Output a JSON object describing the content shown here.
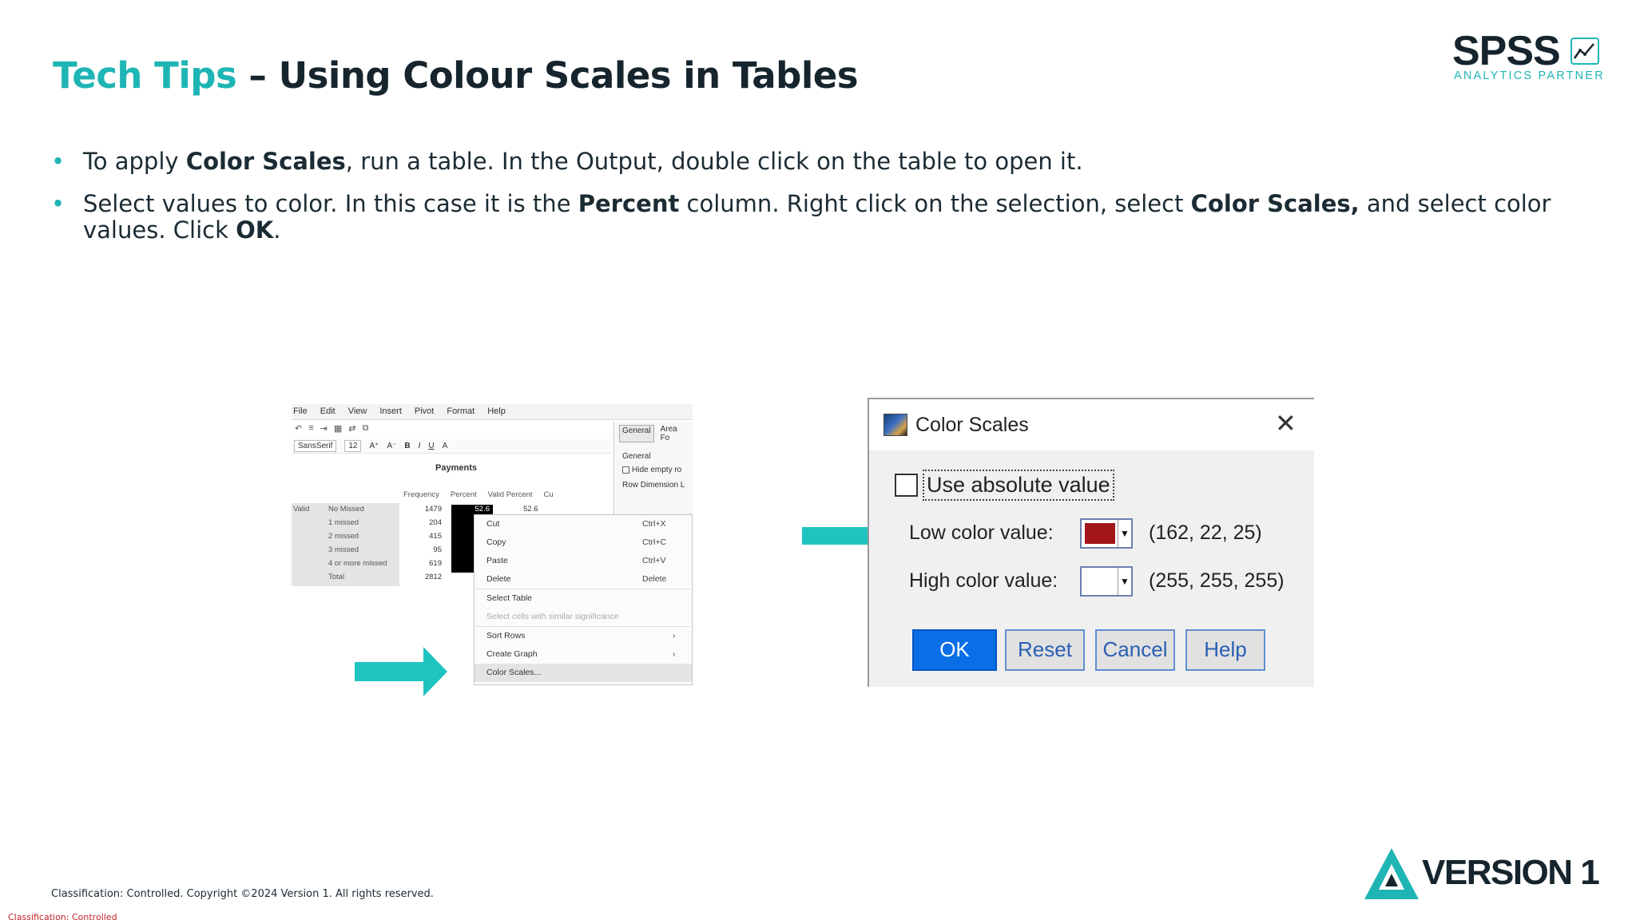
{
  "title": {
    "accent": "Tech Tips",
    "rest": " – Using Colour Scales in Tables"
  },
  "logo": {
    "brand": "SPSS",
    "tagline": "ANALYTICS PARTNER"
  },
  "bullets": [
    {
      "p1": "To apply ",
      "b1": "Color Scales",
      "p2": ", run a table. In the Output, double click on the table to open it."
    },
    {
      "p1": "Select values to color. In this case it is the ",
      "b1": "Percent",
      "p2": " column. Right click on the selection, select ",
      "b2": "Color Scales,",
      "p3": "  and select color values. Click ",
      "b3": "OK",
      "p4": "."
    }
  ],
  "spss": {
    "menu": [
      "File",
      "Edit",
      "View",
      "Insert",
      "Pivot",
      "Format",
      "Help"
    ],
    "toolbar": {
      "font": "SansSerif",
      "size": "12"
    },
    "side_tabs": [
      "General",
      "Area Fo"
    ],
    "side_group": "General",
    "side_option": "Hide empty ro",
    "side_row_label": "Row Dimension L",
    "table_title": "Payments",
    "columns": [
      "Frequency",
      "Percent",
      "Valid Percent",
      "Cu"
    ],
    "group_label": "Valid",
    "rows": [
      {
        "label": "No Missed",
        "freq": "1479",
        "pct": "52.6",
        "vp": "52.6"
      },
      {
        "label": "1 missed",
        "freq": "204"
      },
      {
        "label": "2 missed",
        "freq": "415"
      },
      {
        "label": "3 missed",
        "freq": "95"
      },
      {
        "label": "4 or more missed",
        "freq": "619"
      },
      {
        "label": "Total",
        "freq": "2812"
      }
    ],
    "context_menu": [
      {
        "label": "Cut",
        "shortcut": "Ctrl+X"
      },
      {
        "label": "Copy",
        "shortcut": "Ctrl+C"
      },
      {
        "label": "Paste",
        "shortcut": "Ctrl+V"
      },
      {
        "label": "Delete",
        "shortcut": "Delete"
      },
      {
        "label": "Select Table"
      },
      {
        "label": "Select cells with similar significance"
      },
      {
        "label": "Sort Rows"
      },
      {
        "label": "Create Graph"
      },
      {
        "label": "Color Scales..."
      }
    ]
  },
  "dialog": {
    "title": "Color Scales",
    "checkbox": "Use absolute value",
    "low_label": "Low color value:",
    "low_rgb": "(162, 22, 25)",
    "low_color": "#a21619",
    "high_label": "High color value:",
    "high_rgb": "(255, 255, 255)",
    "high_color": "#ffffff",
    "buttons": {
      "ok": "OK",
      "reset": "Reset",
      "cancel": "Cancel",
      "help": "Help"
    }
  },
  "footer": {
    "copyright": "Classification: Controlled. Copyright ©2024 Version 1. All rights reserved.",
    "classification": "Classification: Controlled"
  },
  "version_logo": "VERSION 1",
  "colors": {
    "accent": "#1fb5b5",
    "dark": "#16252d",
    "ok_button": "#0a6ee6",
    "classification": "#c0262d"
  }
}
